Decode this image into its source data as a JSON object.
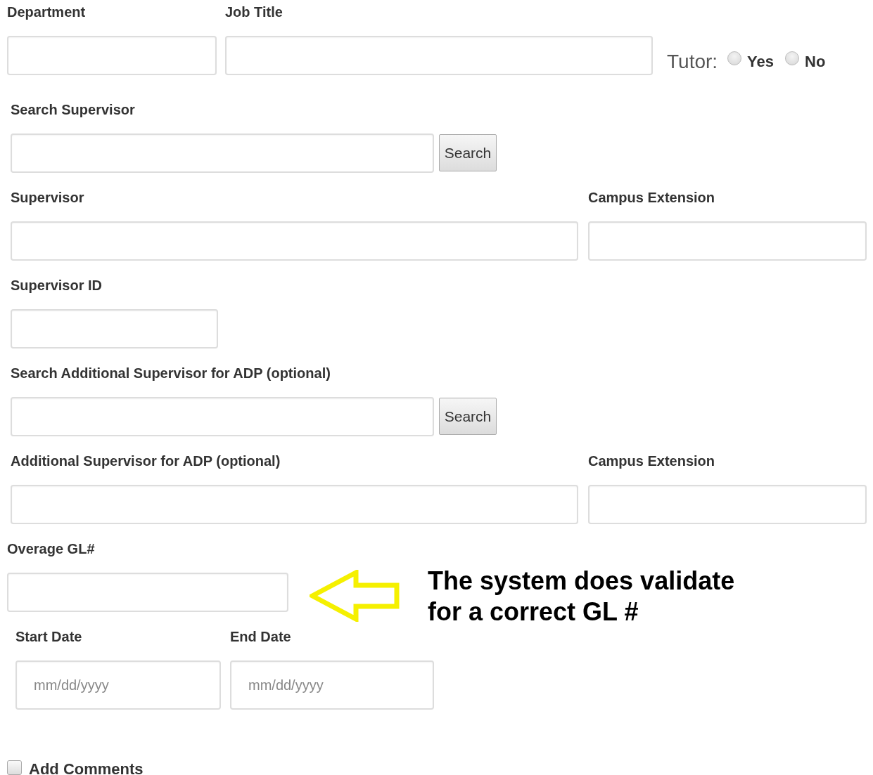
{
  "department": {
    "label": "Department"
  },
  "job_title": {
    "label": "Job Title"
  },
  "tutor": {
    "label": "Tutor:",
    "options": [
      {
        "label": "Yes",
        "selected": false
      },
      {
        "label": "No",
        "selected": false
      }
    ]
  },
  "supervisor_search": {
    "label": "Search Supervisor",
    "button": "Search"
  },
  "supervisor": {
    "label": "Supervisor"
  },
  "supervisor_extension": {
    "label": "Campus Extension"
  },
  "supervisor_id": {
    "label": "Supervisor ID"
  },
  "additional_search": {
    "label": "Search Additional Supervisor for ADP (optional)",
    "button": "Search"
  },
  "additional_supervisor": {
    "label": "Additional Supervisor for ADP (optional)"
  },
  "additional_extension": {
    "label": "Campus Extension"
  },
  "overage_gl": {
    "label": "Overage GL#"
  },
  "annotation": {
    "lines": [
      "The system does validate",
      "for a correct GL #"
    ]
  },
  "start_date": {
    "label": "Start Date",
    "placeholder": "mm/dd/yyyy"
  },
  "end_date": {
    "label": "End Date",
    "placeholder": "mm/dd/yyyy"
  },
  "add_comments": {
    "label": "Add Comments",
    "checked": false
  }
}
